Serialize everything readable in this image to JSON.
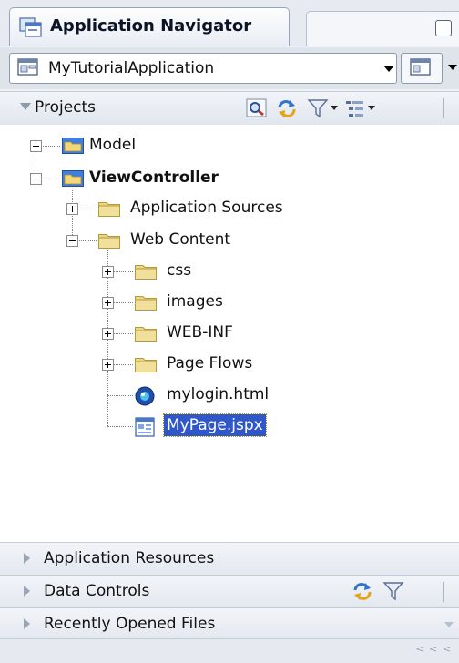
{
  "tab": {
    "title": "Application Navigator"
  },
  "app_selector": {
    "value": "MyTutorialApplication"
  },
  "projects_header": {
    "label": "Projects"
  },
  "tree": {
    "model": "Model",
    "view_controller": "ViewController",
    "application_sources": "Application Sources",
    "web_content": "Web Content",
    "css": "css",
    "images": "images",
    "web_inf": "WEB-INF",
    "page_flows": "Page Flows",
    "mylogin": "mylogin.html",
    "mypage": "MyPage.jspx"
  },
  "sections": {
    "application_resources": "Application Resources",
    "data_controls": "Data Controls",
    "recently_opened": "Recently Opened Files"
  },
  "status": {
    "scroll_hint": "< < <"
  },
  "icons": {
    "tab": "navigator-icon",
    "app": "application-icon",
    "search": "search-icon",
    "sync": "sync-icon",
    "filter": "filter-icon",
    "options": "options-icon",
    "folder": "folder-icon",
    "html": "html-file-icon",
    "jspx": "jspx-file-icon"
  },
  "colors": {
    "selection": "#2f57c9",
    "folder": "#e8d07a",
    "project_folder": "#3e7fe0"
  }
}
